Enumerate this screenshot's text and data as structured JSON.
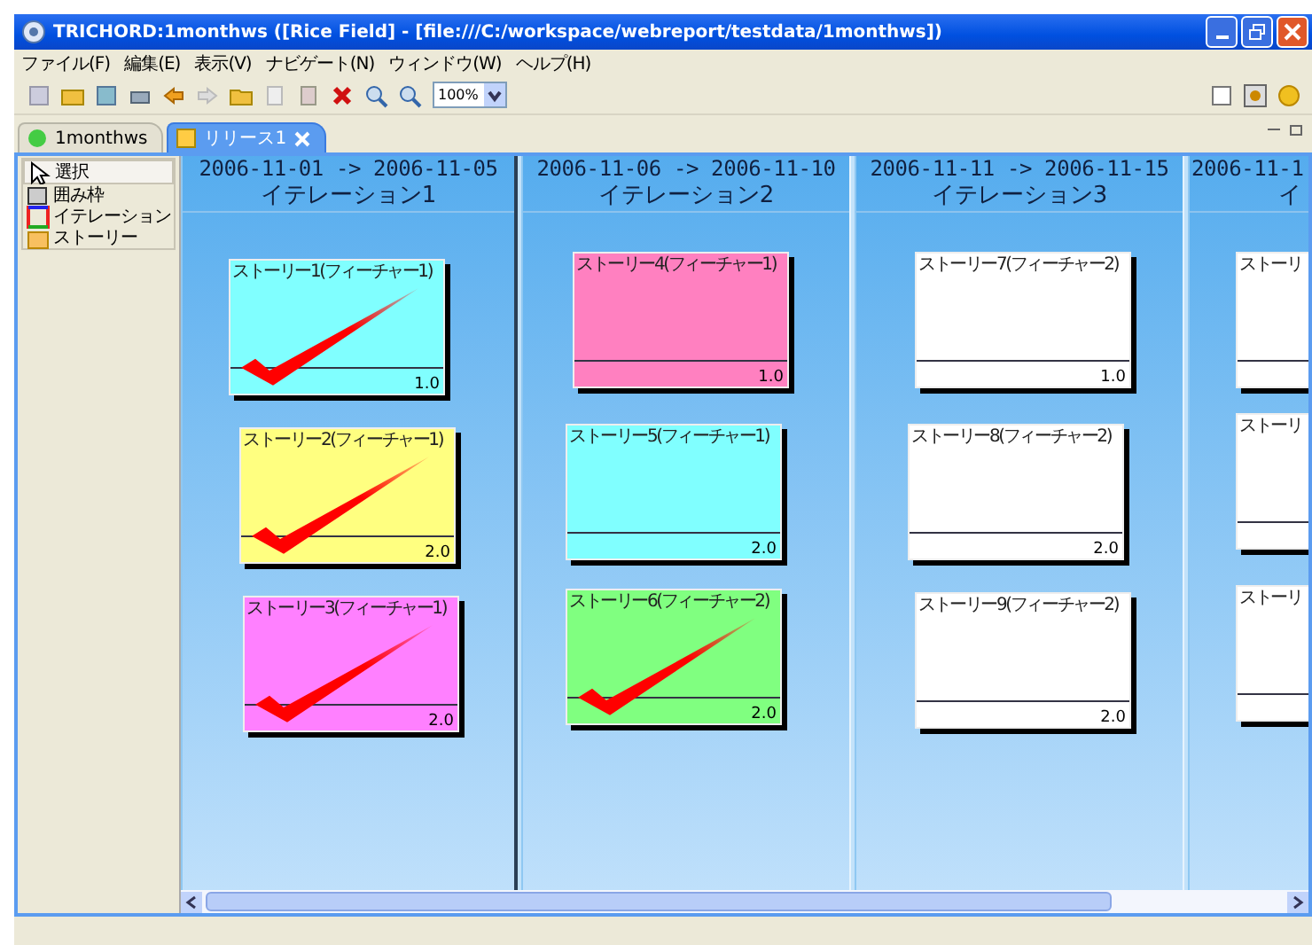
{
  "window": {
    "title": "TRICHORD:1monthws ([Rice Field] - [file:///C:/workspace/webreport/testdata/1monthws])"
  },
  "menu": [
    "ファイル(F)",
    "編集(E)",
    "表示(V)",
    "ナビゲート(N)",
    "ウィンドウ(W)",
    "ヘルプ(H)"
  ],
  "toolbar": {
    "zoom": "100%"
  },
  "tabs": [
    {
      "label": "1monthws",
      "selected": false,
      "closable": false
    },
    {
      "label": "リリース1",
      "selected": true,
      "closable": true
    }
  ],
  "palette": [
    {
      "label": "選択",
      "selected": true
    },
    {
      "label": "囲み枠",
      "selected": false
    },
    {
      "label": "イテレーション",
      "selected": false
    },
    {
      "label": "ストーリー",
      "selected": false
    }
  ],
  "iterations": [
    {
      "dates": "2006-11-01 -> 2006-11-05",
      "name": "イテレーション1",
      "stories": [
        {
          "title": "ストーリー1(フィーチャー1)",
          "points": "1.0",
          "color": "#80ffff",
          "done": true
        },
        {
          "title": "ストーリー2(フィーチャー1)",
          "points": "2.0",
          "color": "#ffff80",
          "done": true
        },
        {
          "title": "ストーリー3(フィーチャー1)",
          "points": "2.0",
          "color": "#ff80ff",
          "done": true
        }
      ]
    },
    {
      "dates": "2006-11-06 -> 2006-11-10",
      "name": "イテレーション2",
      "stories": [
        {
          "title": "ストーリー4(フィーチャー1)",
          "points": "1.0",
          "color": "#ff80c0",
          "done": false
        },
        {
          "title": "ストーリー5(フィーチャー1)",
          "points": "2.0",
          "color": "#80ffff",
          "done": false
        },
        {
          "title": "ストーリー6(フィーチャー2)",
          "points": "2.0",
          "color": "#80ff80",
          "done": true
        }
      ]
    },
    {
      "dates": "2006-11-11 -> 2006-11-15",
      "name": "イテレーション3",
      "stories": [
        {
          "title": "ストーリー7(フィーチャー2)",
          "points": "1.0",
          "color": "#ffffff",
          "done": false
        },
        {
          "title": "ストーリー8(フィーチャー2)",
          "points": "2.0",
          "color": "#ffffff",
          "done": false
        },
        {
          "title": "ストーリー9(フィーチャー2)",
          "points": "2.0",
          "color": "#ffffff",
          "done": false
        }
      ]
    },
    {
      "dates": "2006-11-1",
      "name": "イ",
      "stories": [
        {
          "title": "ストーリ",
          "color": "#ffffff",
          "done": false
        },
        {
          "title": "ストーリ",
          "color": "#ffffff",
          "done": false
        },
        {
          "title": "ストーリ",
          "color": "#ffffff",
          "done": false
        }
      ]
    }
  ]
}
